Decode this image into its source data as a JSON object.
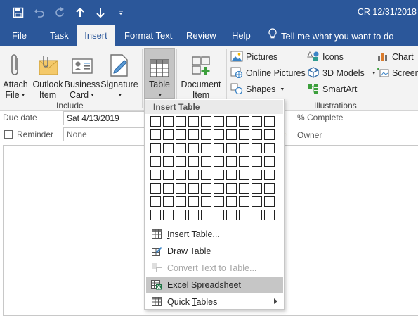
{
  "window": {
    "title": "CR 12/31/2018"
  },
  "quick_access": [
    "save-icon",
    "undo-icon",
    "redo-icon",
    "move-up-icon",
    "move-down-icon",
    "customize-qat-icon"
  ],
  "tabs": [
    {
      "label": "File"
    },
    {
      "label": "Task"
    },
    {
      "label": "Insert",
      "active": true
    },
    {
      "label": "Format Text"
    },
    {
      "label": "Review"
    },
    {
      "label": "Help"
    }
  ],
  "tell_me": {
    "label": "Tell me what you want to do"
  },
  "ribbon": {
    "include": {
      "label": "Include",
      "attach_file": {
        "line1": "Attach",
        "line2": "File"
      },
      "outlook_item": {
        "line1": "Outlook",
        "line2": "Item"
      },
      "business_card": {
        "line1": "Business",
        "line2": "Card"
      },
      "signature": {
        "line1": "Signature"
      }
    },
    "tables": {
      "table": {
        "label": "Table"
      }
    },
    "insert": {
      "document_item": {
        "line1": "Document",
        "line2": "Item"
      }
    },
    "illustrations": {
      "label": "Illustrations",
      "pictures": "Pictures",
      "online_pictures": "Online Pictures",
      "shapes": "Shapes",
      "icons": "Icons",
      "models_3d": "3D Models",
      "smartart": "SmartArt",
      "chart": "Chart",
      "screenshot": "Screens"
    }
  },
  "form": {
    "due_date_label": "Due date",
    "due_date_value": "Sat 4/13/2019",
    "reminder_label": "Reminder",
    "reminder_date": "None",
    "percent_complete_label": "% Complete",
    "owner_label": "Owner"
  },
  "insert_table_menu": {
    "header": "Insert Table",
    "grid": {
      "columns": 10,
      "rows": 8
    },
    "items": [
      {
        "pre": "",
        "key": "I",
        "post": "nsert Table...",
        "icon": "insert-table-icon",
        "state": "normal"
      },
      {
        "pre": "",
        "key": "D",
        "post": "raw Table",
        "icon": "draw-table-icon",
        "state": "normal"
      },
      {
        "pre": "Con",
        "key": "v",
        "post": "ert Text to Table...",
        "icon": "convert-text-icon",
        "state": "disabled"
      },
      {
        "pre": "",
        "key": "E",
        "post": "xcel Spreadsheet",
        "icon": "excel-spreadsheet-icon",
        "state": "highlighted"
      },
      {
        "pre": "Quick ",
        "key": "T",
        "post": "ables",
        "icon": "quick-tables-icon",
        "state": "normal",
        "submenu": true
      }
    ]
  },
  "colors": {
    "accent": "#2b579a",
    "ribbon_bg": "#f3f3f3",
    "highlight": "#c6c6c6"
  }
}
